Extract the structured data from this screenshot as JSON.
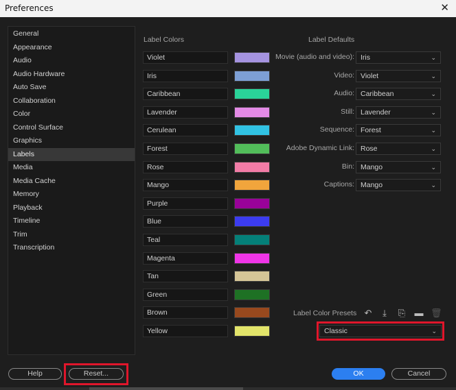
{
  "window": {
    "title": "Preferences",
    "close_glyph": "✕"
  },
  "sidebar": {
    "items": [
      {
        "label": "General"
      },
      {
        "label": "Appearance"
      },
      {
        "label": "Audio"
      },
      {
        "label": "Audio Hardware"
      },
      {
        "label": "Auto Save"
      },
      {
        "label": "Collaboration"
      },
      {
        "label": "Color"
      },
      {
        "label": "Control Surface"
      },
      {
        "label": "Graphics"
      },
      {
        "label": "Labels",
        "selected": true
      },
      {
        "label": "Media"
      },
      {
        "label": "Media Cache"
      },
      {
        "label": "Memory"
      },
      {
        "label": "Playback"
      },
      {
        "label": "Timeline"
      },
      {
        "label": "Trim"
      },
      {
        "label": "Transcription"
      }
    ]
  },
  "label_colors": {
    "title": "Label Colors",
    "items": [
      {
        "name": "Violet",
        "color": "#a593e0"
      },
      {
        "name": "Iris",
        "color": "#7d9fd5"
      },
      {
        "name": "Caribbean",
        "color": "#2ad399"
      },
      {
        "name": "Lavender",
        "color": "#e38ae5"
      },
      {
        "name": "Cerulean",
        "color": "#31c2e3"
      },
      {
        "name": "Forest",
        "color": "#52bd5a"
      },
      {
        "name": "Rose",
        "color": "#f17ca6"
      },
      {
        "name": "Mango",
        "color": "#f1a53c"
      },
      {
        "name": "Purple",
        "color": "#990299"
      },
      {
        "name": "Blue",
        "color": "#3c3cf0"
      },
      {
        "name": "Teal",
        "color": "#048079"
      },
      {
        "name": "Magenta",
        "color": "#ef35e7"
      },
      {
        "name": "Tan",
        "color": "#d5c597"
      },
      {
        "name": "Green",
        "color": "#1e7124"
      },
      {
        "name": "Brown",
        "color": "#98491e"
      },
      {
        "name": "Yellow",
        "color": "#e2e46a"
      }
    ]
  },
  "label_defaults": {
    "title": "Label Defaults",
    "rows": [
      {
        "label": "Movie (audio and video):",
        "value": "Iris"
      },
      {
        "label": "Video:",
        "value": "Violet"
      },
      {
        "label": "Audio:",
        "value": "Caribbean"
      },
      {
        "label": "Still:",
        "value": "Lavender"
      },
      {
        "label": "Sequence:",
        "value": "Forest"
      },
      {
        "label": "Adobe Dynamic Link:",
        "value": "Rose"
      },
      {
        "label": "Bin:",
        "value": "Mango"
      },
      {
        "label": "Captions:",
        "value": "Mango"
      }
    ]
  },
  "presets": {
    "label": "Label Color Presets",
    "selected": "Classic",
    "tools": [
      {
        "icon": "undo-icon",
        "glyph": "↶",
        "enabled": true
      },
      {
        "icon": "import-icon",
        "glyph": "⤓",
        "enabled": true
      },
      {
        "icon": "save-preset-icon",
        "glyph": "⎘",
        "enabled": true
      },
      {
        "icon": "folder-icon",
        "glyph": "▬",
        "enabled": true
      },
      {
        "icon": "trash-icon",
        "glyph": "🗑",
        "enabled": false
      }
    ]
  },
  "buttons": {
    "help": "Help",
    "reset": "Reset...",
    "ok": "OK",
    "cancel": "Cancel"
  },
  "colors": {
    "accent": "#2c7ff0",
    "highlight": "#e0162b"
  }
}
